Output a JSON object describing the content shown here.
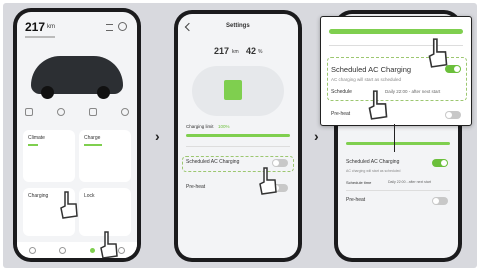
{
  "phone1": {
    "range_value": "217",
    "range_unit": "km",
    "card_left_title": "Climate",
    "card_right_title": "Charge",
    "card_bottom_left_title": "Charging",
    "card_bottom_right_title": "Lock"
  },
  "phone2": {
    "header_title": "Settings",
    "range_value": "217",
    "range_unit": "km",
    "percent_value": "42",
    "percent_unit": "%",
    "charging_limit_label": "Charging limit",
    "charging_limit_value": "100%",
    "scheduled_label": "Scheduled AC Charging",
    "pre_heat_label": "Pre-heat"
  },
  "phone3": {
    "scheduled_label": "Scheduled AC Charging",
    "scheduled_desc": "AC charging will start as scheduled",
    "schedule_label": "Schedule",
    "schedule_time": "Daily 22:00 - after next start",
    "pre_heat_label": "Pre-heat",
    "lower_scheduled_label": "Scheduled AC Charging",
    "lower_scheduled_desc": "AC charging will start as scheduled",
    "lower_schedule_label": "Schedule time",
    "lower_schedule_value": "Daily 22:00 - after next start",
    "lower_pre_heat_label": "Pre-heat"
  },
  "arrows": {
    "a1": "›",
    "a2": "›"
  }
}
